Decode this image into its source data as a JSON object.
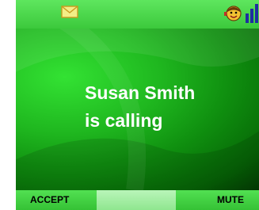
{
  "status_bar": {
    "icons": [
      "envelope-icon",
      "face-icon",
      "signal-bars-icon"
    ]
  },
  "call": {
    "caller_line_1": "Susan Smith",
    "caller_line_2": "is calling"
  },
  "softkeys": {
    "left_label": "ACCEPT",
    "center_label": "",
    "right_label": "MUTE"
  },
  "colors": {
    "accent_green": "#3fd43f",
    "text_white": "#ffffff",
    "signal_blue": "#1e2ea0"
  }
}
